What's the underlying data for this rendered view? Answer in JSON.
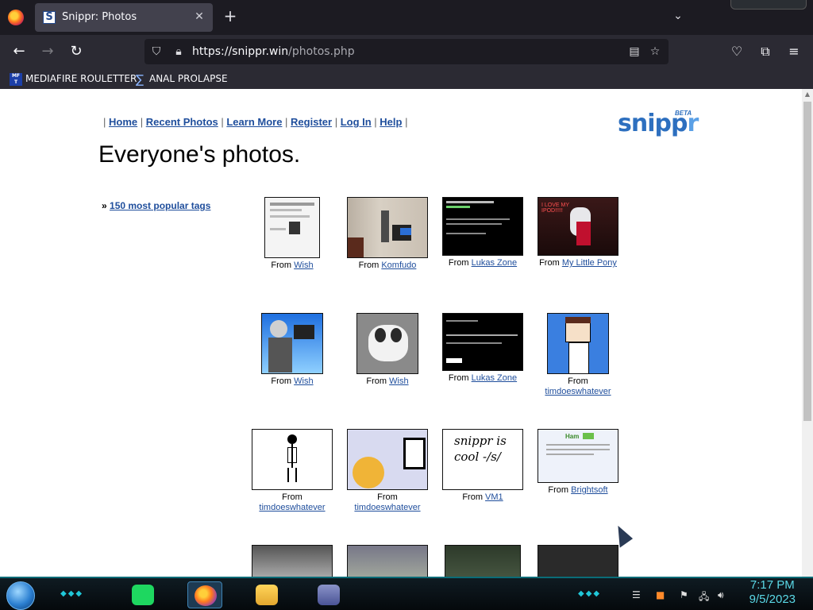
{
  "browser": {
    "tab_title": "Snippr: Photos",
    "tab_favicon_letter": "S",
    "url_host": "https://snippr.win",
    "url_path": "/photos.php",
    "new_tab_glyph": "+",
    "close_glyph": "✕"
  },
  "bookmarks": [
    {
      "label": "MEDIAFIRE ROULETTER",
      "icon": "mediafire-icon",
      "icon_text": "MF T"
    },
    {
      "label": "ANAL PROLAPSE",
      "icon": "sigma-icon",
      "icon_text": "∑"
    }
  ],
  "site": {
    "nav": [
      {
        "label": "Home"
      },
      {
        "label": "Recent Photos"
      },
      {
        "label": "Learn More"
      },
      {
        "label": "Register"
      },
      {
        "label": "Log In"
      },
      {
        "label": "Help"
      }
    ],
    "logo_text_main": "snipp",
    "logo_text_end": "r",
    "logo_badge": "BETA",
    "title": "Everyone's photos.",
    "tags_prefix": "»",
    "tags_link": "150 most popular tags",
    "from_label": "From",
    "photos": [
      {
        "source": "Wish",
        "theme": "doc"
      },
      {
        "source": "Komfudo",
        "theme": "room"
      },
      {
        "source": "Lukas Zone",
        "theme": "terminal"
      },
      {
        "source": "My Little Pony",
        "theme": "pony"
      },
      {
        "source": "Wish",
        "theme": "drawing-blue"
      },
      {
        "source": "Wish",
        "theme": "dog"
      },
      {
        "source": "Lukas Zone",
        "theme": "terminal"
      },
      {
        "source": "timdoeswhatever",
        "theme": "pixel-person"
      },
      {
        "source": "timdoeswhatever",
        "theme": "stick"
      },
      {
        "source": "timdoeswhatever",
        "theme": "emoji"
      },
      {
        "source": "VM1",
        "theme": "handwriting"
      },
      {
        "source": "Brightsoft",
        "theme": "web"
      },
      {
        "source": "",
        "theme": "partial-gray"
      },
      {
        "source": "",
        "theme": "partial-plant"
      },
      {
        "source": "",
        "theme": "partial-green"
      },
      {
        "source": "",
        "theme": "partial-dark"
      }
    ],
    "handwriting_text": "snippr is cool -/s/",
    "pony_text": "I LOVE MY IPOD!!!!!",
    "web_brand": "Ham"
  },
  "taskbar": {
    "time": "7:17 PM",
    "date": "9/5/2023"
  },
  "colors": {
    "link": "#1f4e9c",
    "chrome_dark": "#1c1b22",
    "taskbar_accent": "#20c7d8"
  }
}
